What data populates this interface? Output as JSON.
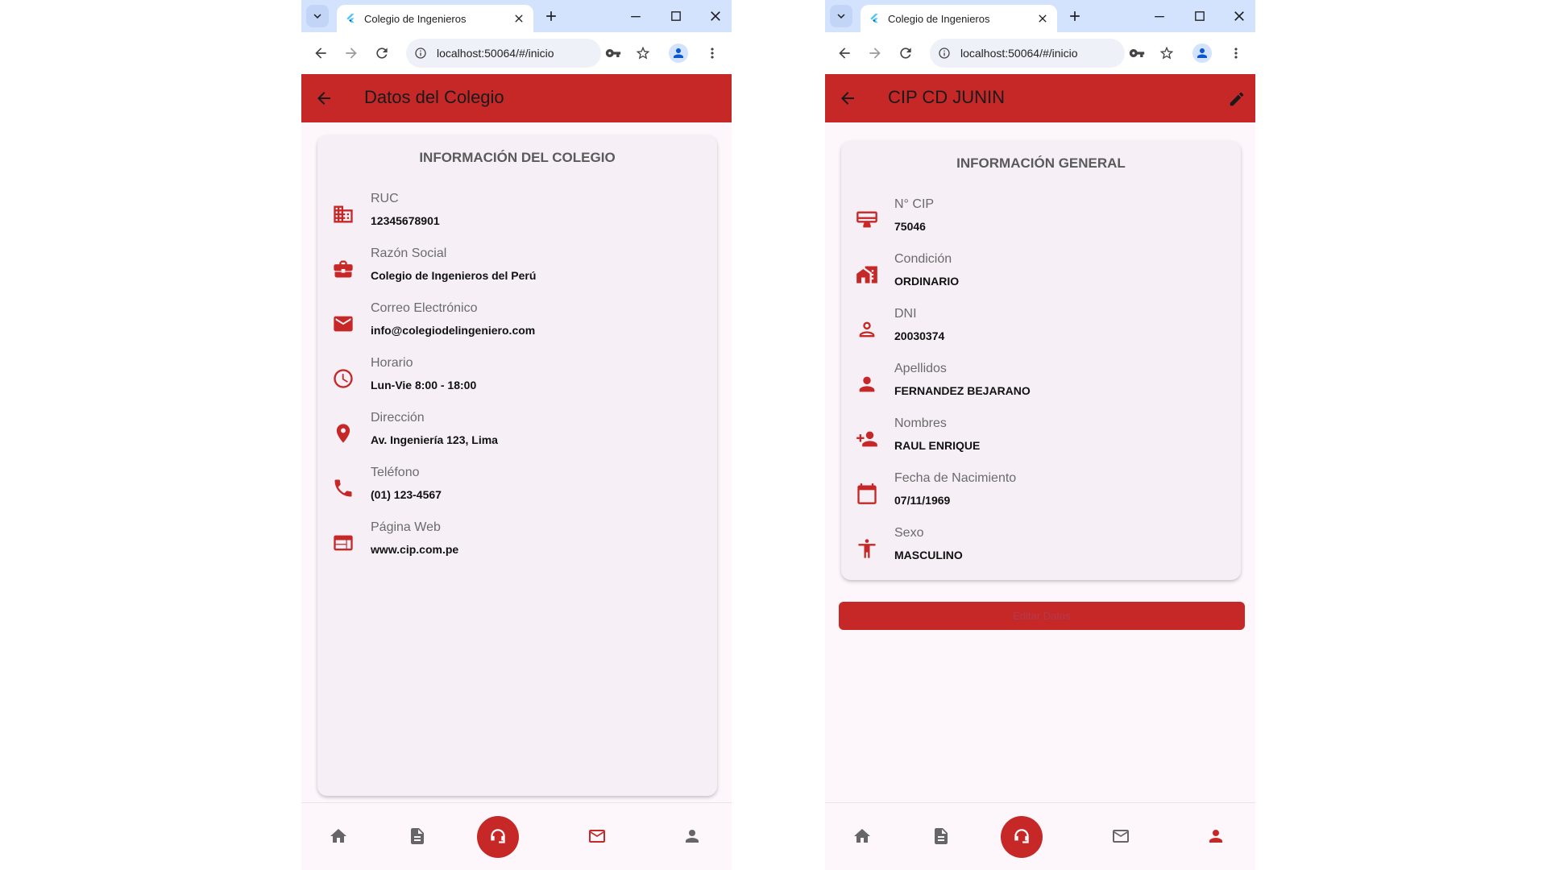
{
  "browser": {
    "tab_title": "Colegio de Ingenieros",
    "url": "localhost:50064/#/inicio"
  },
  "colors": {
    "accent": "#c62828",
    "background": "#fdf6fb",
    "card": "#f6eff5"
  },
  "left": {
    "appbar_title": "Datos del Colegio",
    "card_heading": "INFORMACIÓN DEL COLEGIO",
    "rows": [
      {
        "icon": "building-icon",
        "label": "RUC",
        "value": "12345678901"
      },
      {
        "icon": "briefcase-icon",
        "label": "Razón Social",
        "value": "Colegio de Ingenieros del Perú"
      },
      {
        "icon": "mail-icon",
        "label": "Correo Electrónico",
        "value": "info@colegiodelingeniero.com"
      },
      {
        "icon": "clock-icon",
        "label": "Horario",
        "value": "Lun-Vie 8:00 - 18:00"
      },
      {
        "icon": "location-pin-icon",
        "label": "Dirección",
        "value": "Av. Ingeniería 123, Lima"
      },
      {
        "icon": "phone-icon",
        "label": "Teléfono",
        "value": "(01) 123-4567"
      },
      {
        "icon": "web-icon",
        "label": "Página Web",
        "value": "www.cip.com.pe"
      }
    ],
    "nav_active": "mail"
  },
  "right": {
    "appbar_title": "CIP CD JUNIN",
    "card_heading": "INFORMACIÓN GENERAL",
    "rows": [
      {
        "icon": "card-icon",
        "label": "N° CIP",
        "value": "75046"
      },
      {
        "icon": "home-work-icon",
        "label": "Condición",
        "value": "ORDINARIO"
      },
      {
        "icon": "person-outline-icon",
        "label": "DNI",
        "value": "20030374"
      },
      {
        "icon": "person-icon",
        "label": "Apellidos",
        "value": "FERNANDEZ BEJARANO"
      },
      {
        "icon": "person-add-icon",
        "label": "Nombres",
        "value": "RAUL ENRIQUE"
      },
      {
        "icon": "calendar-icon",
        "label": "Fecha de Nacimiento",
        "value": "07/11/1969"
      },
      {
        "icon": "accessibility-icon",
        "label": "Sexo",
        "value": "MASCULINO"
      }
    ],
    "edit_button": "Editar Datos",
    "nav_active": "profile"
  }
}
